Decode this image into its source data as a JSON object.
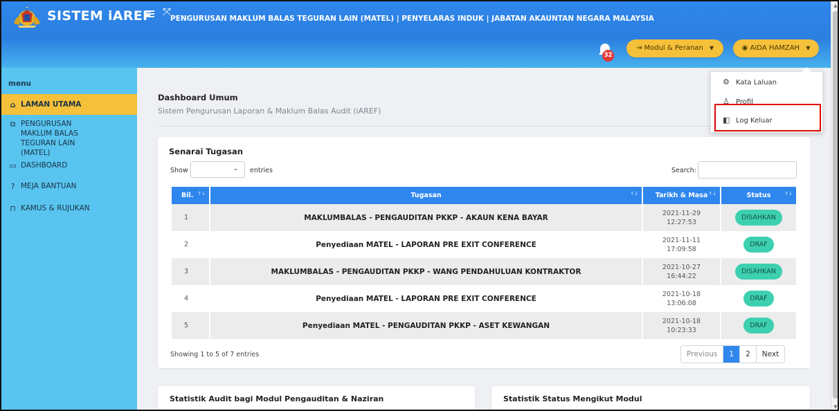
{
  "header": {
    "brand": "SISTEM iAREF",
    "title": "PENGURUSAN MAKLUM BALAS TEGURAN LAIN (MATEL) | PENYELARAS INDUK | JABATAN AKAUNTAN NEGARA MALAYSIA",
    "notification_count": "32",
    "modul_label": "Modul & Peranan",
    "user_label": "AIDA HAMZAH"
  },
  "sidebar": {
    "label": "menu",
    "items": [
      {
        "label": "LAMAN UTAMA",
        "icon": "home-icon"
      },
      {
        "label": "PENGURUSAN MAKLUM BALAS TEGURAN LAIN (MATEL)",
        "icon": "copy-icon"
      },
      {
        "label": "DASHBOARD",
        "icon": "layout-icon"
      },
      {
        "label": "MEJA BANTUAN",
        "icon": "question-icon"
      },
      {
        "label": "KAMUS & RUJUKAN",
        "icon": "book-icon"
      }
    ]
  },
  "main": {
    "title": "Dashboard Umum",
    "subtitle": "Sistem Pengurusan Laporan & Maklum Balas Audit (iAREF)"
  },
  "tasks": {
    "title": "Senarai Tugasan",
    "show_label": "Show",
    "entries_label": "entries",
    "search_label": "Search:",
    "search_value": "",
    "columns": [
      "Bil.",
      "Tugasan",
      "Tarikh & Masa",
      "Status"
    ],
    "rows": [
      {
        "bil": "1",
        "task": "MAKLUMBALAS - PENGAUDITAN PKKP - AKAUN KENA BAYAR",
        "date": "2021-11-29",
        "time": "12:27:53",
        "status": "DISAHKAN"
      },
      {
        "bil": "2",
        "task": "Penyediaan MATEL - LAPORAN PRE EXIT CONFERENCE",
        "date": "2021-11-11",
        "time": "17:09:58",
        "status": "DRAF"
      },
      {
        "bil": "3",
        "task": "MAKLUMBALAS - PENGAUDITAN PKKP - WANG PENDAHULUAN KONTRAKTOR",
        "date": "2021-10-27",
        "time": "16:44:22",
        "status": "DISAHKAN"
      },
      {
        "bil": "4",
        "task": "Penyediaan MATEL - LAPORAN PRE EXIT CONFERENCE",
        "date": "2021-10-18",
        "time": "13:06:08",
        "status": "DRAF"
      },
      {
        "bil": "5",
        "task": "Penyediaan MATEL - PENGAUDITAN PKKP - ASET KEWANGAN",
        "date": "2021-10-18",
        "time": "10:23:33",
        "status": "DRAF"
      }
    ],
    "showing_text": "Showing 1 to 5 of 7 entries",
    "pagination": {
      "previous": "Previous",
      "pages": [
        "1",
        "2"
      ],
      "next": "Next",
      "current": "1"
    }
  },
  "stats": {
    "audit_title": "Statistik Audit bagi Modul Pengauditan & Naziran",
    "status_title": "Statistik Status Mengikut Modul"
  },
  "user_menu": {
    "items": [
      {
        "label": "Kata Laluan",
        "icon": "gear-icon"
      },
      {
        "label": "Profil",
        "icon": "user-icon"
      },
      {
        "label": "Log Keluar",
        "icon": "logout-icon"
      }
    ]
  },
  "colors": {
    "header": "#2f86ea",
    "sidebar": "#58c4ef",
    "accent": "#f5c03a",
    "table_header": "#2f87ee",
    "status_badge": "#3dd0b0",
    "highlight": "#e00000"
  }
}
